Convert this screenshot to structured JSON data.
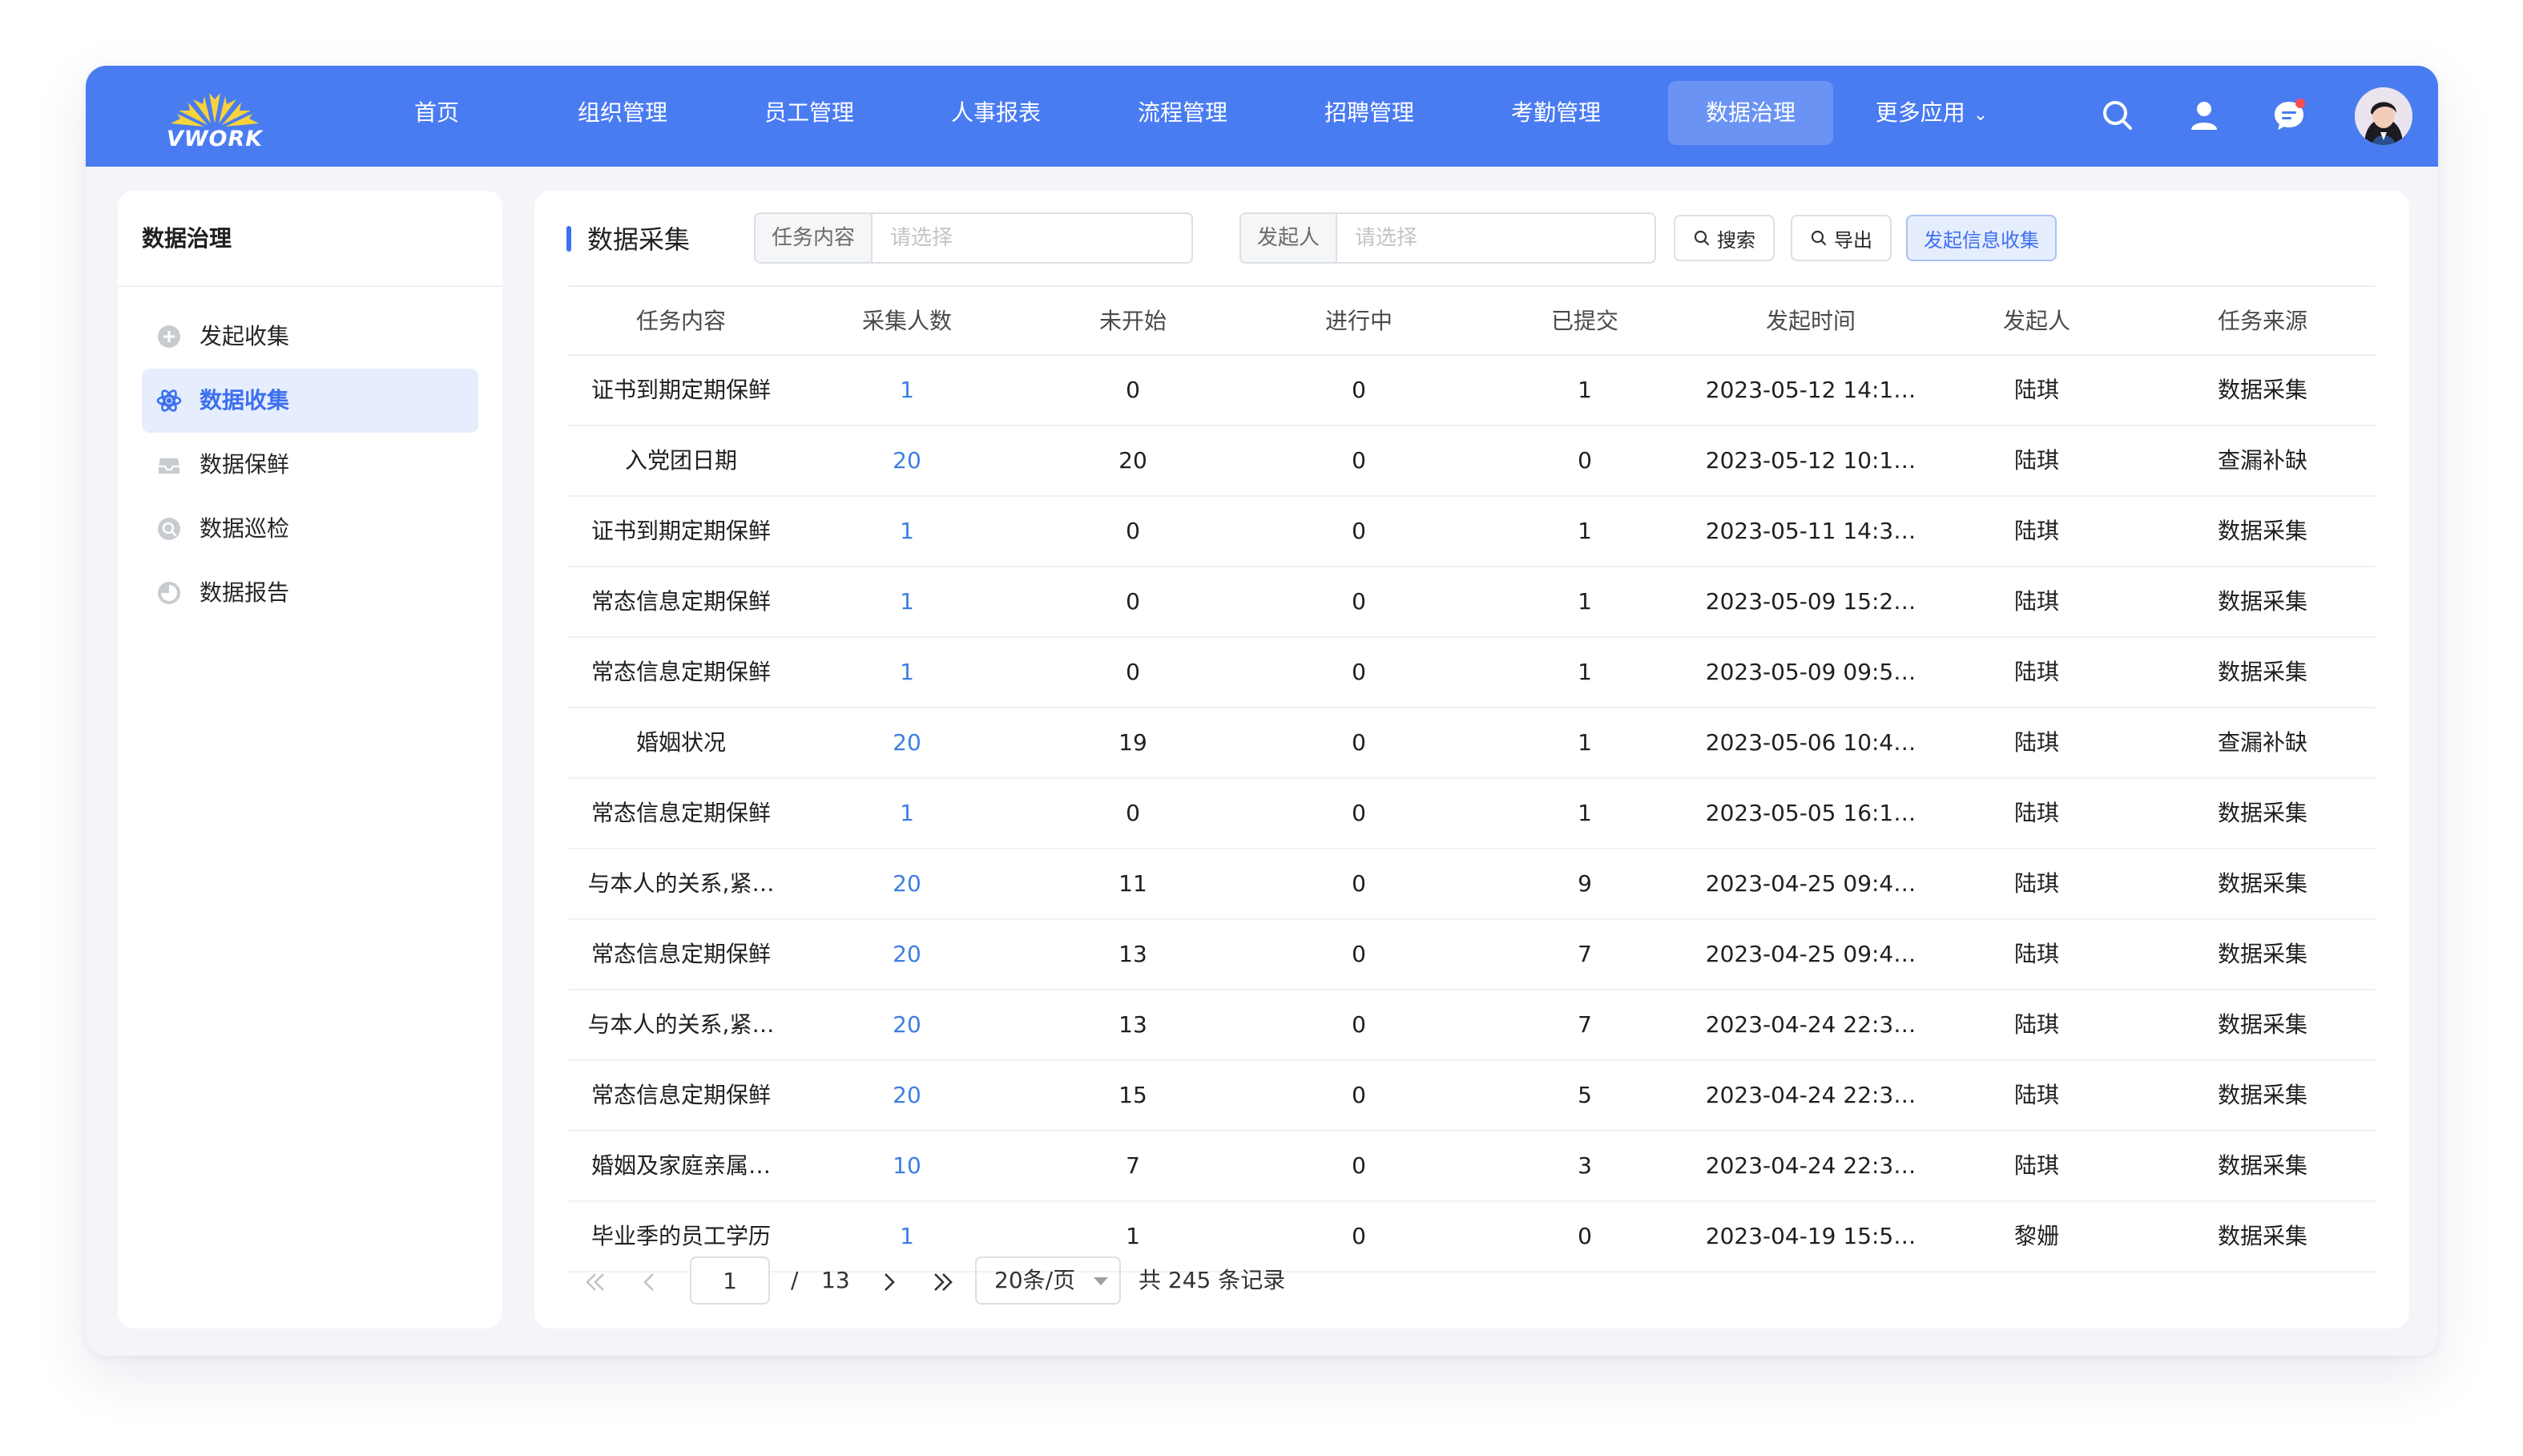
{
  "app": {
    "logo_text": "VWORK",
    "colors": {
      "primary": "#4a7cf1",
      "accent": "#3d6ff0",
      "link": "#3d7fe3",
      "logo_yellow": "#f7d23b",
      "badge": "#ff4d4f"
    }
  },
  "nav": {
    "items": [
      {
        "label": "首页"
      },
      {
        "label": "组织管理"
      },
      {
        "label": "员工管理"
      },
      {
        "label": "人事报表"
      },
      {
        "label": "流程管理"
      },
      {
        "label": "招聘管理"
      },
      {
        "label": "考勤管理"
      },
      {
        "label": "数据治理",
        "active": true
      }
    ],
    "more_label": "更多应用",
    "icons": [
      "search-icon",
      "user-icon",
      "message-icon"
    ]
  },
  "sidebar": {
    "title": "数据治理",
    "items": [
      {
        "label": "发起收集",
        "icon": "plus-circle-icon"
      },
      {
        "label": "数据收集",
        "icon": "atom-icon",
        "active": true
      },
      {
        "label": "数据保鲜",
        "icon": "inbox-icon"
      },
      {
        "label": "数据巡检",
        "icon": "scan-icon"
      },
      {
        "label": "数据报告",
        "icon": "pie-icon"
      }
    ]
  },
  "main": {
    "title": "数据采集",
    "filters": {
      "task_label": "任务内容",
      "task_placeholder": "请选择",
      "initiator_label": "发起人",
      "initiator_placeholder": "请选择"
    },
    "buttons": {
      "search": "搜索",
      "export": "导出",
      "launch": "发起信息收集"
    },
    "table": {
      "columns": [
        "任务内容",
        "采集人数",
        "未开始",
        "进行中",
        "已提交",
        "发起时间",
        "发起人",
        "任务来源"
      ],
      "rows": [
        [
          "证书到期定期保鲜",
          "1",
          "0",
          "0",
          "1",
          "2023-05-12 14:1…",
          "陆琪",
          "数据采集"
        ],
        [
          "入党团日期",
          "20",
          "20",
          "0",
          "0",
          "2023-05-12 10:1…",
          "陆琪",
          "查漏补缺"
        ],
        [
          "证书到期定期保鲜",
          "1",
          "0",
          "0",
          "1",
          "2023-05-11 14:3…",
          "陆琪",
          "数据采集"
        ],
        [
          "常态信息定期保鲜",
          "1",
          "0",
          "0",
          "1",
          "2023-05-09 15:2…",
          "陆琪",
          "数据采集"
        ],
        [
          "常态信息定期保鲜",
          "1",
          "0",
          "0",
          "1",
          "2023-05-09 09:5…",
          "陆琪",
          "数据采集"
        ],
        [
          "婚姻状况",
          "20",
          "19",
          "0",
          "1",
          "2023-05-06 10:4…",
          "陆琪",
          "查漏补缺"
        ],
        [
          "常态信息定期保鲜",
          "1",
          "0",
          "0",
          "1",
          "2023-05-05 16:1…",
          "陆琪",
          "数据采集"
        ],
        [
          "与本人的关系,紧…",
          "20",
          "11",
          "0",
          "9",
          "2023-04-25 09:4…",
          "陆琪",
          "数据采集"
        ],
        [
          "常态信息定期保鲜",
          "20",
          "13",
          "0",
          "7",
          "2023-04-25 09:4…",
          "陆琪",
          "数据采集"
        ],
        [
          "与本人的关系,紧…",
          "20",
          "13",
          "0",
          "7",
          "2023-04-24 22:3…",
          "陆琪",
          "数据采集"
        ],
        [
          "常态信息定期保鲜",
          "20",
          "15",
          "0",
          "5",
          "2023-04-24 22:3…",
          "陆琪",
          "数据采集"
        ],
        [
          "婚姻及家庭亲属…",
          "10",
          "7",
          "0",
          "3",
          "2023-04-24 22:3…",
          "陆琪",
          "数据采集"
        ],
        [
          "毕业季的员工学历",
          "1",
          "1",
          "0",
          "0",
          "2023-04-19 15:5…",
          "黎姗",
          "数据采集"
        ]
      ]
    },
    "pagination": {
      "current": "1",
      "separator": "/",
      "total_pages": "13",
      "page_size": "20条/页",
      "total_text": "共 245 条记录"
    }
  }
}
